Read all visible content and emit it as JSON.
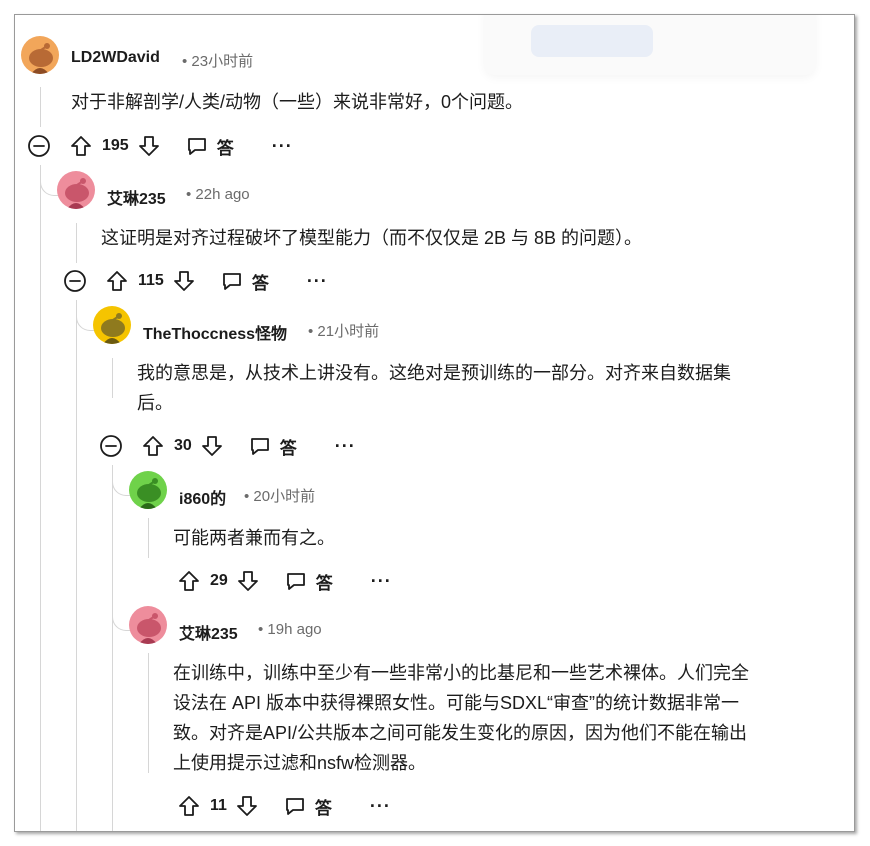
{
  "comments": [
    {
      "user": "LD2WDavid",
      "time": "23小时前",
      "text": "对于非解剖学/人类/动物（一些）来说非常好，0个问题。",
      "votes": "195",
      "reply": "答",
      "more": "···",
      "avatar_color": "#f2a65a"
    },
    {
      "user": "艾琳235",
      "time": "22h ago",
      "text": "这证明是对齐过程破坏了模型能力（而不仅仅是 2B 与 8B 的问题）。",
      "votes": "115",
      "reply": "答",
      "more": "···",
      "avatar_color": "#ee8d9c"
    },
    {
      "user": "TheThoccness怪物",
      "time": "21小时前",
      "text_line1": "我的意思是，从技术上讲没有。这绝对是预训练的一部分。对齐来自数据集",
      "text_line2": "后。",
      "votes": "30",
      "reply": "答",
      "more": "···",
      "avatar_color": "#f5c400"
    },
    {
      "user": "i860的",
      "time": "20小时前",
      "text": "可能两者兼而有之。",
      "votes": "29",
      "reply": "答",
      "more": "···",
      "avatar_color": "#6fd24a"
    },
    {
      "user": "艾琳235",
      "time": "19h ago",
      "text_line1": "在训练中，训练中至少有一些非常小的比基尼和一些艺术裸体。人们完全",
      "text_line2": "设法在 API 版本中获得裸照女性。可能与SDXL“审查”的统计数据非常一",
      "text_line3": "致。对齐是API/公共版本之间可能发生变化的原因，因为他们不能在输出",
      "text_line4": "上使用提示过滤和nsfw检测器。",
      "votes": "11",
      "reply": "答",
      "more": "···",
      "avatar_color": "#ee8d9c"
    }
  ]
}
